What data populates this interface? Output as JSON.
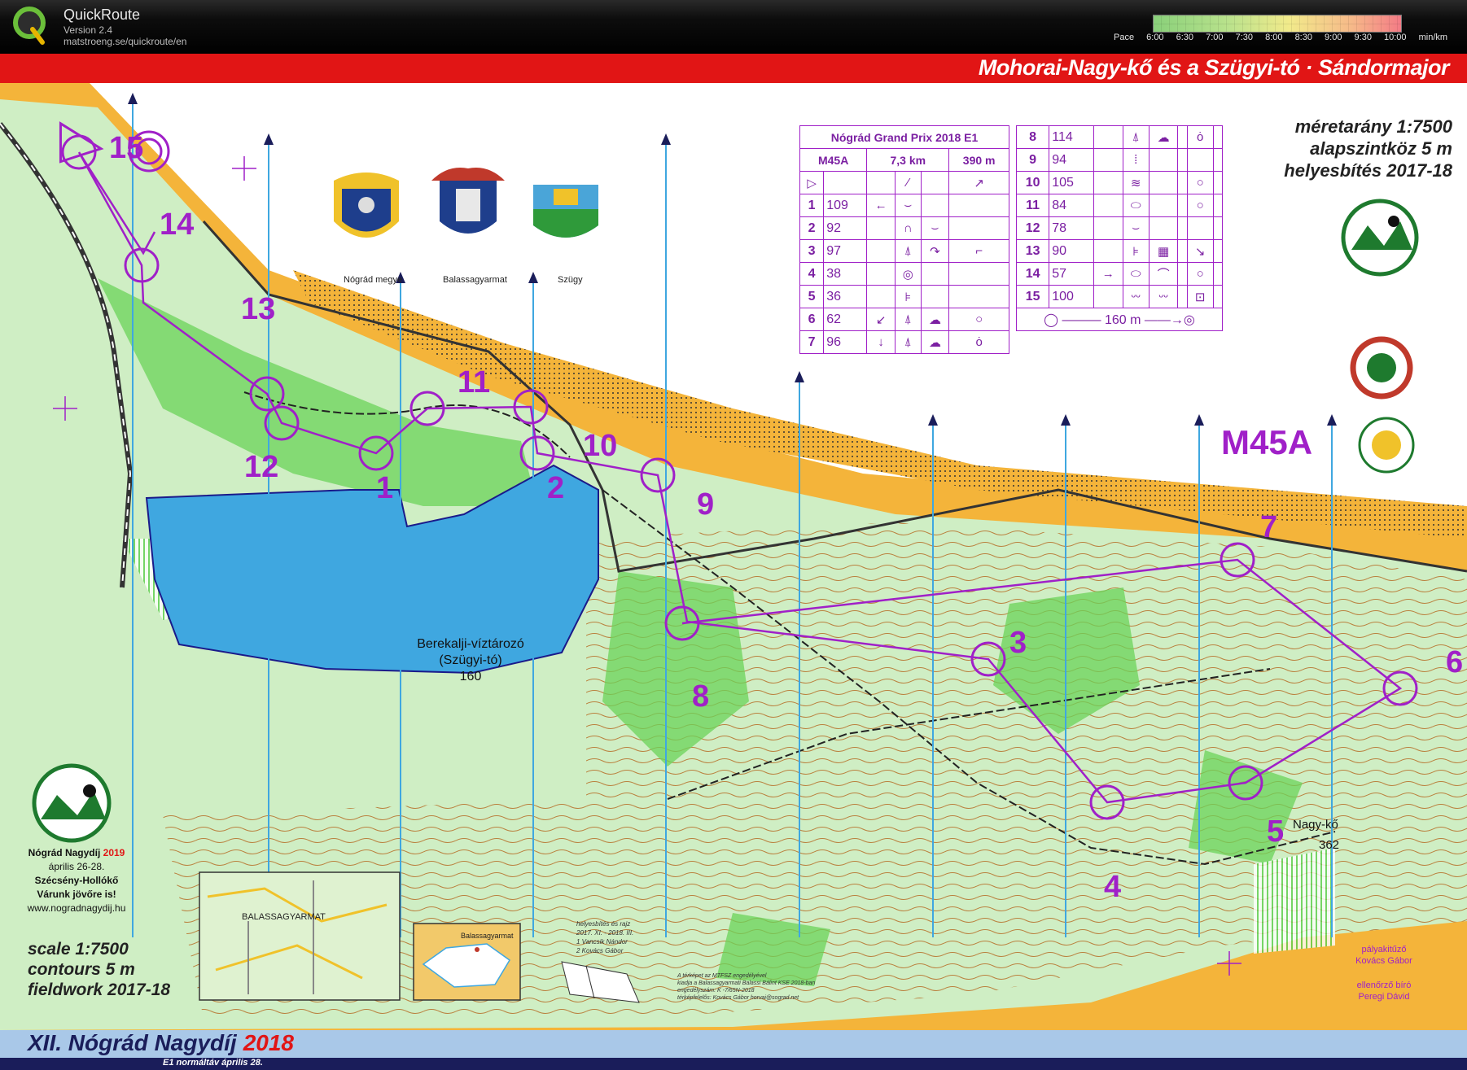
{
  "app": {
    "name": "QuickRoute",
    "version": "Version 2.4",
    "url": "matstroeng.se/quickroute/en",
    "pace_label": "Pace",
    "pace_ticks": [
      "6:00",
      "6:30",
      "7:00",
      "7:30",
      "8:00",
      "8:30",
      "9:00",
      "9:30",
      "10:00"
    ],
    "pace_unit": "min/km"
  },
  "map": {
    "title": "Mohorai-Nagy-kő és a Szügyi-tó · Sándormajor",
    "scale_hu": [
      "méretarány 1:7500",
      "alapszintköz 5 m",
      "helyesbítés 2017-18"
    ],
    "scale_en": [
      "scale 1:7500",
      "contours 5 m",
      "fieldwork 2017-18"
    ],
    "class": "M45A",
    "lake": [
      "Berekalji-víztározó",
      "(Szügyi-tó)",
      "160"
    ],
    "hill": [
      "Nagy-kő",
      "362"
    ],
    "coats": [
      "Nógrád megye",
      "Balassagyarmat",
      "Szügy"
    ],
    "inset_labels": [
      "BALASSAGYARMAT",
      "Balassagyarmat"
    ],
    "controls": [
      "1",
      "2",
      "3",
      "4",
      "5",
      "6",
      "7",
      "8",
      "9",
      "10",
      "11",
      "12",
      "13",
      "14",
      "15"
    ]
  },
  "description": {
    "event": "Nógrád Grand Prix 2018 E1",
    "class": "M45A",
    "length": "7,3 km",
    "climb": "390 m",
    "rows": [
      {
        "n": "1",
        "code": "109"
      },
      {
        "n": "2",
        "code": "92"
      },
      {
        "n": "3",
        "code": "97"
      },
      {
        "n": "4",
        "code": "38"
      },
      {
        "n": "5",
        "code": "36"
      },
      {
        "n": "6",
        "code": "62"
      },
      {
        "n": "7",
        "code": "96"
      }
    ],
    "rows2": [
      {
        "n": "8",
        "code": "114"
      },
      {
        "n": "9",
        "code": "94"
      },
      {
        "n": "10",
        "code": "105"
      },
      {
        "n": "11",
        "code": "84"
      },
      {
        "n": "12",
        "code": "78"
      },
      {
        "n": "13",
        "code": "90"
      },
      {
        "n": "14",
        "code": "57"
      },
      {
        "n": "15",
        "code": "100"
      }
    ],
    "finish": "160 m"
  },
  "event_info": {
    "name": "Nógrád Nagydíj",
    "year": "2019",
    "dates": "április 26-28.",
    "place": "Szécsény-Hollókő",
    "invite": "Várunk jövőre is!",
    "web": "www.nogradnagydij.hu"
  },
  "credits": {
    "revision": [
      "helyesbítés és rajz",
      "2017. XI. - 2018. III.",
      "1  Vancsik Nándor",
      "2  Kovács Gábor"
    ],
    "permit": [
      "A térképet az MTFSZ engedélyével",
      "kiadja a Balassagyarmati Balassi Bálint KSE 2018-ban",
      "engedélyszám: K -7/65N-2018",
      "térképfelelős: Kovács Gábor  horvai@sograd.net"
    ],
    "officials": [
      "pályakitűző",
      "Kovács Gábor",
      "ellenőrző bíró",
      "Peregi Dávid"
    ]
  },
  "footer": {
    "title": "XII. Nógrád Nagydíj",
    "year": "2018",
    "sub": "E1 normáltáv   április 28."
  },
  "colors": {
    "course": "#a020c8",
    "lake": "#3fa7e0",
    "open_land": "#f4b43a",
    "forest_green": "#5fcf4f",
    "header_red": "#e11515"
  }
}
